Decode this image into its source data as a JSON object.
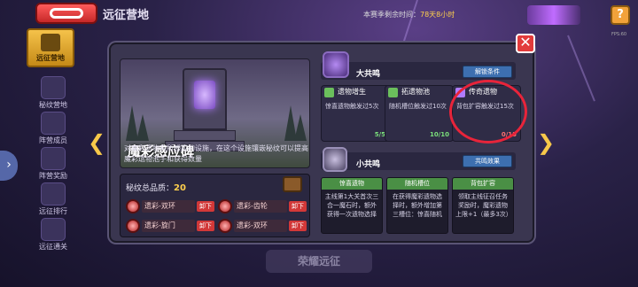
{
  "top": {
    "title": "远征营地",
    "season_label": "本赛季剩余时间：",
    "season_time": "78天8小时"
  },
  "fps": "FPS:60",
  "sidebar": {
    "active_label": "远征营地",
    "items": [
      {
        "label": "秘纹营地"
      },
      {
        "label": "阵营成员"
      },
      {
        "label": "阵营奖励"
      },
      {
        "label": "远征排行"
      },
      {
        "label": "远征通关"
      }
    ]
  },
  "bottom_button": "荣耀远征",
  "monument": {
    "title": "魔彩感应碑",
    "description": "对魔彩遗物有所感应的设施，在这个设施镶嵌秘纹可以提高魔彩遗物池子和获得数量"
  },
  "pattern": {
    "quality_label": "秘纹总品质：",
    "quality_value": "20",
    "slots": [
      {
        "name": "遗彩-双环",
        "action": "卸下"
      },
      {
        "name": "遗彩-齿轮",
        "action": "卸下"
      },
      {
        "name": "遗彩-旋门",
        "action": "卸下"
      },
      {
        "name": "遗彩-双环",
        "action": "卸下"
      }
    ]
  },
  "big_resonance": {
    "title": "大共鸣",
    "button": "解锁条件",
    "conditions": [
      {
        "title": "遗物增生",
        "body": "惊喜遗物触发过5次",
        "progress": "5/5"
      },
      {
        "title": "拓遗物池",
        "body": "随机槽位触发过10次",
        "progress": "10/10"
      },
      {
        "title": "传奇遗物",
        "body": "背包扩容触发过15次",
        "progress": "0/15"
      }
    ]
  },
  "small_resonance": {
    "title": "小共鸣",
    "button": "共鸣效果",
    "effects": [
      {
        "title": "惊喜遗物",
        "text": "主线第1大关首次三合一魔石时，额外获得一次遗物选择"
      },
      {
        "title": "随机槽位",
        "text": "在获得魔彩遗物选择时，额外增加第三槽位：惊喜随机"
      },
      {
        "title": "背包扩容",
        "text": "领取主线征召任务奖励时，魔彩遗物上限+1（最多3次）"
      }
    ]
  }
}
